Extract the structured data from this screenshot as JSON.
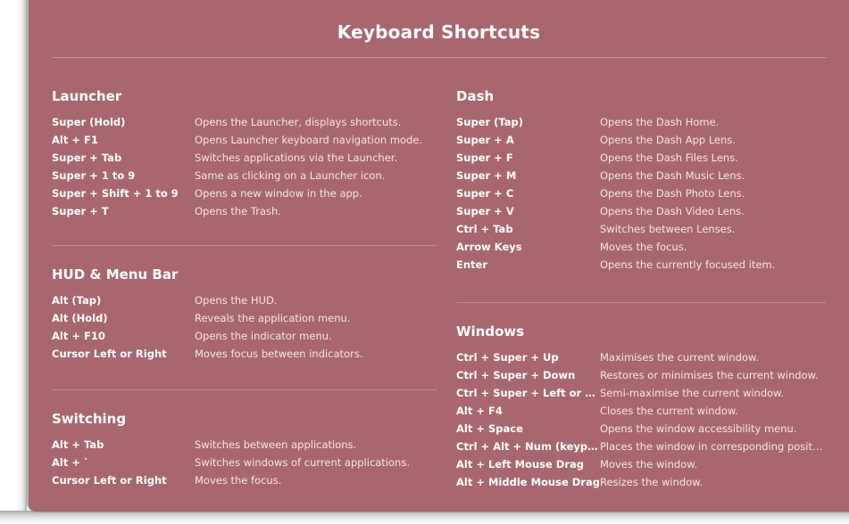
{
  "overlay": {
    "title": "Keyboard Shortcuts",
    "background_color": "#a8676e",
    "title_color": "#ffffff",
    "key_color": "#ffffff",
    "description_color": "#f3e6e7",
    "divider_color": "rgba(255,255,255,0.26)"
  },
  "columns": {
    "left": [
      {
        "id": "launcher",
        "title": "Launcher",
        "has_rule_above": false,
        "shortcuts": [
          {
            "key": "Super (Hold)",
            "desc": "Opens the Launcher, displays shortcuts."
          },
          {
            "key": "Alt + F1",
            "desc": "Opens Launcher keyboard navigation mode."
          },
          {
            "key": "Super + Tab",
            "desc": "Switches applications via the Launcher."
          },
          {
            "key": "Super + 1 to 9",
            "desc": "Same as clicking on a Launcher icon."
          },
          {
            "key": "Super + Shift + 1 to 9",
            "desc": "Opens a new window in the app."
          },
          {
            "key": "Super + T",
            "desc": "Opens the Trash."
          }
        ]
      },
      {
        "id": "hud-menu-bar",
        "title": "HUD & Menu Bar",
        "has_rule_above": true,
        "shortcuts": [
          {
            "key": "Alt (Tap)",
            "desc": "Opens the HUD."
          },
          {
            "key": "Alt (Hold)",
            "desc": "Reveals the application menu."
          },
          {
            "key": "Alt + F10",
            "desc": "Opens the indicator menu."
          },
          {
            "key": "Cursor Left or Right",
            "desc": "Moves focus between indicators."
          }
        ]
      },
      {
        "id": "switching",
        "title": "Switching",
        "has_rule_above": true,
        "shortcuts": [
          {
            "key": "Alt + Tab",
            "desc": "Switches between applications."
          },
          {
            "key": "Alt + `",
            "desc": "Switches windows of current applications."
          },
          {
            "key": "Cursor Left or Right",
            "desc": "Moves the focus."
          }
        ]
      }
    ],
    "right": [
      {
        "id": "dash",
        "title": "Dash",
        "has_rule_above": false,
        "shortcuts": [
          {
            "key": "Super (Tap)",
            "desc": "Opens the Dash Home."
          },
          {
            "key": "Super + A",
            "desc": "Opens the Dash App Lens."
          },
          {
            "key": "Super + F",
            "desc": "Opens the Dash Files Lens."
          },
          {
            "key": "Super + M",
            "desc": "Opens the Dash Music Lens."
          },
          {
            "key": "Super + C",
            "desc": "Opens the Dash Photo Lens."
          },
          {
            "key": "Super + V",
            "desc": "Opens the Dash Video Lens."
          },
          {
            "key": "Ctrl + Tab",
            "desc": "Switches between Lenses."
          },
          {
            "key": "Arrow Keys",
            "desc": "Moves the focus."
          },
          {
            "key": "Enter",
            "desc": "Opens the currently focused item."
          }
        ]
      },
      {
        "id": "windows",
        "title": "Windows",
        "has_rule_above": true,
        "shortcuts": [
          {
            "key": "Ctrl + Super + Up",
            "desc": "Maximises the current window."
          },
          {
            "key": "Ctrl + Super + Down",
            "desc": "Restores or minimises the current window."
          },
          {
            "key": "Ctrl + Super + Left or Ri...",
            "desc": "Semi-maximise the current window."
          },
          {
            "key": "Alt + F4",
            "desc": "Closes the current window."
          },
          {
            "key": "Alt + Space",
            "desc": "Opens the window accessibility menu."
          },
          {
            "key": "Ctrl + Alt + Num (keypad)",
            "desc": "Places the window in corresponding position."
          },
          {
            "key": "Alt + Left Mouse Drag",
            "desc": "Moves the window."
          },
          {
            "key": "Alt + Middle Mouse Drag",
            "desc": "Resizes the window."
          }
        ]
      }
    ]
  }
}
